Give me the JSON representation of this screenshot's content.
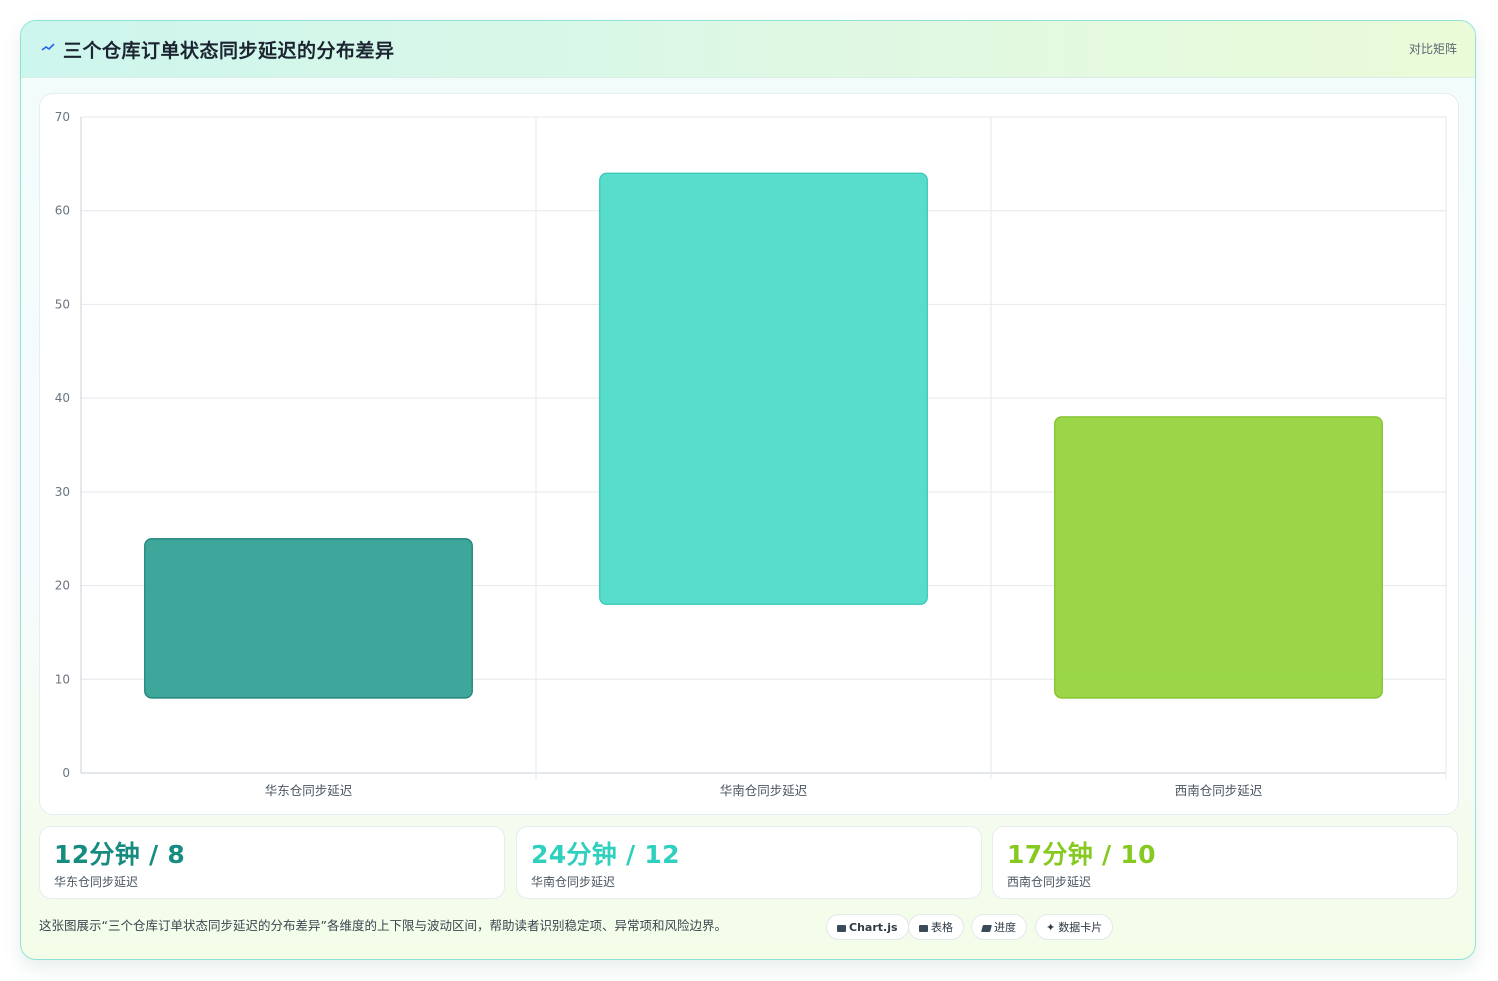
{
  "header": {
    "title": "三个仓库订单状态同步延迟的分布差异",
    "badge": "对比矩阵",
    "icon": "trend-line-icon"
  },
  "chart_data": {
    "type": "bar",
    "subtype": "floating-range",
    "categories": [
      "华东仓同步延迟",
      "华南仓同步延迟",
      "西南仓同步延迟"
    ],
    "ranges": [
      [
        8,
        25
      ],
      [
        18,
        64
      ],
      [
        8,
        38
      ]
    ],
    "ylim": [
      0,
      70
    ],
    "yticks": [
      0,
      10,
      20,
      30,
      40,
      50,
      60,
      70
    ],
    "colors": [
      "#2e9e92",
      "#4ad9c8",
      "#93d23a"
    ],
    "border_colors": [
      "#1b7f74",
      "#33c7b4",
      "#7fbf26"
    ],
    "grid": true,
    "legend": "none"
  },
  "stats": [
    {
      "value": "12分钟 / 8",
      "label": "华东仓同步延迟",
      "color": "#168b80"
    },
    {
      "value": "24分钟 / 12",
      "label": "华南仓同步延迟",
      "color": "#2fd0bd"
    },
    {
      "value": "17分钟 / 10",
      "label": "西南仓同步延迟",
      "color": "#86c920"
    }
  ],
  "description": "这张图展示“三个仓库订单状态同步延迟的分布差异”各维度的上下限与波动区间，帮助读者识别稳定项、异常项和风险边界。",
  "tags": [
    {
      "label": "Chart.js",
      "icon": "chart-icon"
    },
    {
      "label": "表格",
      "icon": "table-icon"
    },
    {
      "label": "进度",
      "icon": "progress-icon"
    },
    {
      "label": "数据卡片",
      "icon": "sparkle-icon"
    }
  ]
}
